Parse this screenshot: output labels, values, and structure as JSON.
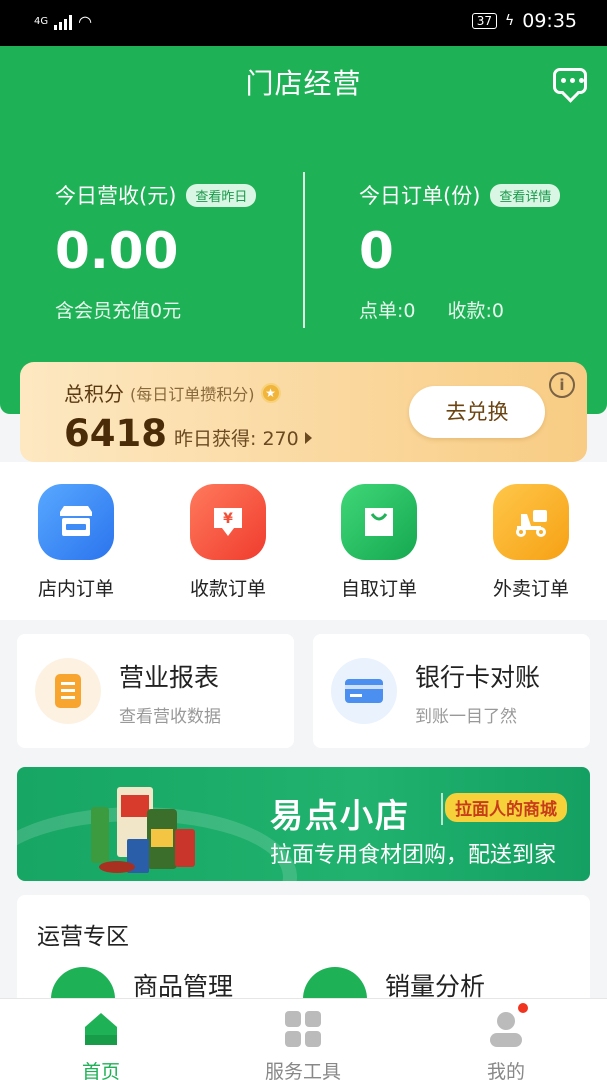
{
  "status_bar": {
    "network": "4G",
    "time": "09:35",
    "battery": "37"
  },
  "header": {
    "title": "门店经营"
  },
  "stats": {
    "revenue": {
      "label": "今日营收(元)",
      "pill": "查看昨日",
      "value": "0.00",
      "sub": "含会员充值0元"
    },
    "orders": {
      "label": "今日订单(份)",
      "pill": "查看详情",
      "value": "0",
      "sub1": "点单:0",
      "sub2": "收款:0"
    }
  },
  "points": {
    "label": "总积分",
    "note": "(每日订单攒积分)",
    "value": "6418",
    "yesterday": "昨日获得: 270",
    "button": "去兑换",
    "info": "i"
  },
  "quick_actions": [
    {
      "label": "店内订单",
      "icon": "store-icon"
    },
    {
      "label": "收款订单",
      "icon": "yuan-download-icon"
    },
    {
      "label": "自取订单",
      "icon": "shopping-bag-icon"
    },
    {
      "label": "外卖订单",
      "icon": "delivery-scooter-icon"
    }
  ],
  "cards": [
    {
      "title": "营业报表",
      "subtitle": "查看营收数据",
      "icon": "report-icon"
    },
    {
      "title": "银行卡对账",
      "subtitle": "到账一目了然",
      "icon": "bank-card-icon"
    }
  ],
  "banner": {
    "title": "易点小店",
    "tag": "拉面人的商城",
    "subtitle": "拉面专用食材团购，配送到家"
  },
  "operations": {
    "title": "运营专区",
    "items": [
      {
        "label": "商品管理",
        "icon": "product-management-icon"
      },
      {
        "label": "销量分析",
        "icon": "sales-analysis-icon"
      }
    ]
  },
  "tabs": [
    {
      "label": "首页",
      "icon": "home-icon",
      "active": true
    },
    {
      "label": "服务工具",
      "icon": "grid-icon",
      "active": false
    },
    {
      "label": "我的",
      "icon": "profile-icon",
      "active": false
    }
  ],
  "colors": {
    "brand_green": "#1eb156",
    "points_gold": "#f8cc83",
    "badge_red": "#f0341f"
  }
}
